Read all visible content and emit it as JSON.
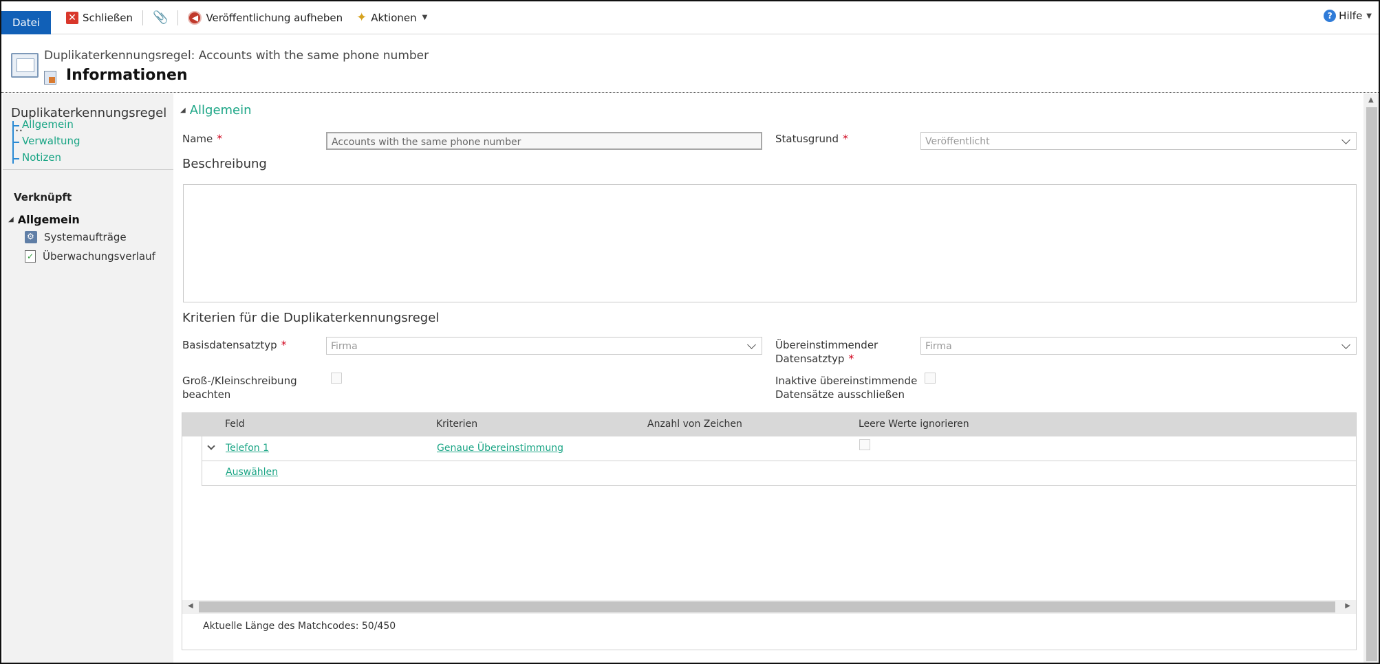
{
  "toolbar": {
    "file_tab": "Datei",
    "close_label": "Schließen",
    "unpublish_label": "Veröffentlichung aufheben",
    "actions_label": "Aktionen",
    "help_label": "Hilfe"
  },
  "header": {
    "rule_title": "Duplikaterkennungsregel: Accounts with the same phone number",
    "form_title": "Informationen"
  },
  "leftnav": {
    "title": "Duplikaterkennungsregel ...",
    "links": [
      "Allgemein",
      "Verwaltung",
      "Notizen"
    ],
    "related_heading": "Verknüpft",
    "group_label": "Allgemein",
    "items": [
      "Systemaufträge",
      "Überwachungsverlauf"
    ]
  },
  "main": {
    "section_title": "Allgemein",
    "name_label": "Name",
    "name_value": "Accounts with the same phone number",
    "status_reason_label": "Statusgrund",
    "status_reason_value": "Veröffentlicht",
    "description_heading": "Beschreibung",
    "criteria_heading": "Kriterien für die Duplikaterkennungsregel",
    "base_record_type_label": "Basisdatensatztyp",
    "base_record_type_value": "Firma",
    "matching_record_type_label_line1": "Übereinstimmender",
    "matching_record_type_label_line2": "Datensatztyp",
    "matching_record_type_value": "Firma",
    "case_sensitive_label_line1": "Groß-/Kleinschreibung",
    "case_sensitive_label_line2": "beachten",
    "exclude_inactive_label_line1": "Inaktive übereinstimmende",
    "exclude_inactive_label_line2": "Datensätze ausschließen",
    "grid": {
      "columns": [
        "Feld",
        "Kriterien",
        "Anzahl von Zeichen",
        "Leere Werte ignorieren"
      ],
      "rows": [
        {
          "field": "Telefon 1",
          "criteria": "Genaue Übereinstimmung"
        }
      ],
      "select_link": "Auswählen"
    },
    "match_code_length": "Aktuelle Länge des Matchcodes: 50/450"
  },
  "colors": {
    "file_tab_blue": "#1160b7",
    "link_teal": "#1aa585",
    "required_red": "#d0021b"
  }
}
